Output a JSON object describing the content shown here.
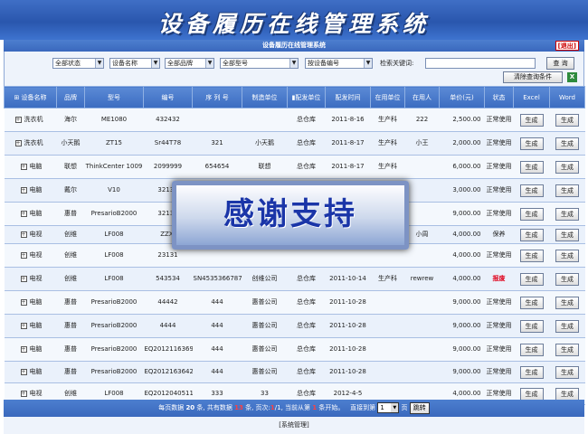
{
  "header": {
    "title": "设备履历在线管理系统",
    "subtitle": "设备履历在线管理系统",
    "logout": "[退出]"
  },
  "filters": {
    "status": "全部状态",
    "name": "设备名称",
    "brand": "全部品牌",
    "model": "全部型号",
    "code": "按设备编号",
    "keyword_label": "检索关键词:",
    "keyword_value": "",
    "search_button": "查 询",
    "clear_button": "清除查询条件"
  },
  "columns": [
    "设备名称",
    "品牌",
    "型号",
    "编号",
    "序 列 号",
    "制造单位",
    "配发单位",
    "配发时间",
    "在用单位",
    "在用人",
    "单价(元)",
    "状态",
    "Excel",
    "Word"
  ],
  "rows": [
    {
      "name": "洗衣机",
      "brand": "海尔",
      "model": "ME1080",
      "code": "432432",
      "serial": "",
      "maker": "",
      "dept": "总仓库",
      "date": "2011-8-16",
      "user_dept": "生产科",
      "user": "222",
      "price": "2,500.00",
      "status": "正常使用"
    },
    {
      "name": "洗衣机",
      "brand": "小天鹅",
      "model": "ZT15",
      "code": "Sr44T78",
      "serial": "321",
      "maker": "小天鹅",
      "dept": "总仓库",
      "date": "2011-8-17",
      "user_dept": "生产科",
      "user": "小王",
      "price": "2,000.00",
      "status": "正常使用"
    },
    {
      "name": "电脑",
      "brand": "联想",
      "model": "ThinkCenter 1009",
      "code": "2099999",
      "serial": "654654",
      "maker": "联想",
      "dept": "总仓库",
      "date": "2011-8-17",
      "user_dept": "生产科",
      "user": "",
      "price": "6,000.00",
      "status": "正常使用"
    },
    {
      "name": "电脑",
      "brand": "戴尔",
      "model": "V10",
      "code": "32132",
      "serial": "",
      "maker": "",
      "dept": "",
      "date": "",
      "user_dept": "",
      "user": "",
      "price": "3,000.00",
      "status": "正常使用"
    },
    {
      "name": "电脑",
      "brand": "惠普",
      "model": "PresarioB2000",
      "code": "32132",
      "serial": "",
      "maker": "",
      "dept": "",
      "date": "",
      "user_dept": "",
      "user": "",
      "price": "9,000.00",
      "status": "正常使用"
    },
    {
      "name": "电视",
      "brand": "创维",
      "model": "LF008",
      "code": "ZZX-",
      "serial": "",
      "maker": "",
      "dept": "",
      "date": "",
      "user_dept": "",
      "user": "小周",
      "price": "4,000.00",
      "status": "保养"
    },
    {
      "name": "电视",
      "brand": "创维",
      "model": "LF008",
      "code": "23131",
      "serial": "",
      "maker": "",
      "dept": "",
      "date": "",
      "user_dept": "",
      "user": "",
      "price": "4,000.00",
      "status": "正常使用"
    },
    {
      "name": "电视",
      "brand": "创维",
      "model": "LF008",
      "code": "543534",
      "serial": "SN4535366787",
      "maker": "创维公司",
      "dept": "总仓库",
      "date": "2011-10-14",
      "user_dept": "生产科",
      "user": "rewrew",
      "price": "4,000.00",
      "status": "报废"
    },
    {
      "name": "电脑",
      "brand": "惠普",
      "model": "PresarioB2000",
      "code": "44442",
      "serial": "444",
      "maker": "惠普公司",
      "dept": "总仓库",
      "date": "2011-10-28",
      "user_dept": "",
      "user": "",
      "price": "9,000.00",
      "status": "正常使用"
    },
    {
      "name": "电脑",
      "brand": "惠普",
      "model": "PresarioB2000",
      "code": "4444",
      "serial": "444",
      "maker": "惠普公司",
      "dept": "总仓库",
      "date": "2011-10-28",
      "user_dept": "",
      "user": "",
      "price": "9,000.00",
      "status": "正常使用"
    },
    {
      "name": "电脑",
      "brand": "惠普",
      "model": "PresarioB2000",
      "code": "EQ20121163695",
      "serial": "444",
      "maker": "惠普公司",
      "dept": "总仓库",
      "date": "2011-10-28",
      "user_dept": "",
      "user": "",
      "price": "9,000.00",
      "status": "正常使用"
    },
    {
      "name": "电脑",
      "brand": "惠普",
      "model": "PresarioB2000",
      "code": "EQ20121636422",
      "serial": "444",
      "maker": "惠普公司",
      "dept": "总仓库",
      "date": "2011-10-28",
      "user_dept": "",
      "user": "",
      "price": "9,000.00",
      "status": "正常使用"
    },
    {
      "name": "电视",
      "brand": "创维",
      "model": "LF008",
      "code": "EQ20120405112",
      "serial": "333",
      "maker": "33",
      "dept": "总仓库",
      "date": "2012-4-5",
      "user_dept": "",
      "user": "",
      "price": "4,000.00",
      "status": "正常使用"
    }
  ],
  "row_actions": {
    "generate": "生成"
  },
  "pager": {
    "per_page_prefix": "每页数据",
    "per_page": "20",
    "count_mid": "条, 共有数据",
    "total": "13",
    "pages_mid": "条, 页次:",
    "page_current": "1",
    "page_total": "/1, 当前从第",
    "start": "1",
    "start_suffix": "条开始。",
    "jump_label": "直接到第",
    "jump_value": "1",
    "jump_unit": "页",
    "jump_button": "跳转"
  },
  "footer": {
    "text": "[系统管理]"
  },
  "watermark": {
    "text": "感谢支持"
  },
  "colors": {
    "header_blue": "#2a56ad",
    "scrapped_red": "#e0001a"
  }
}
